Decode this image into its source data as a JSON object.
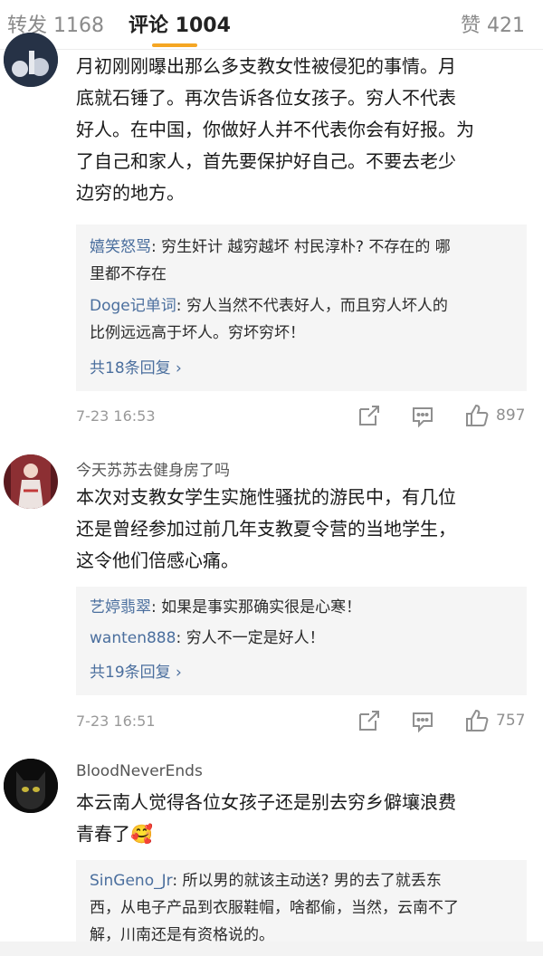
{
  "tabs": {
    "repost": "转发 1168",
    "comment": "评论 1004",
    "like": "赞 421"
  },
  "comments": [
    {
      "text": "月初刚刚曝出那么多支教女性被侵犯的事情。月底就石锤了。再次告诉各位女孩子。穷人不代表好人。在中国，你做好人并不代表你会有好报。为了自己和家人，首先要保护好自己。不要去老少边穷的地方。",
      "lines": [
        "月初刚刚曝出那么多支教女性被侵犯的事情。月",
        "底就石锤了。再次告诉各位女孩子。穷人不代表",
        "好人。在中国，你做好人并不代表你会有好报。为",
        "了自己和家人，首先要保护好自己。不要去老少",
        "边穷的地方。"
      ],
      "replies": [
        {
          "name": "嬉笑怒骂",
          "lines": [
            "穷生奸计 越穷越坏 村民淳朴? 不存在的 哪",
            "里都不存在"
          ]
        },
        {
          "name": "Doge记单词",
          "lines": [
            "穷人当然不代表好人，而且穷人坏人的",
            "比例远远高于坏人。穷坏穷坏！"
          ]
        }
      ],
      "reply_count": "共18条回复 ›",
      "time": "7-23 16:53",
      "likes": "897"
    },
    {
      "username": "今天苏苏去健身房了吗",
      "lines": [
        "本次对支教女学生实施性骚扰的游民中，有几位",
        "还是曾经参加过前几年支教夏令营的当地学生，",
        "这令他们倍感心痛。"
      ],
      "replies": [
        {
          "name": "艺婷翡翠",
          "lines": [
            "如果是事实那确实很是心寒！"
          ]
        },
        {
          "name": "wanten888",
          "lines": [
            "穷人不一定是好人！"
          ]
        }
      ],
      "reply_count": "共19条回复 ›",
      "time": "7-23 16:51",
      "likes": "757"
    },
    {
      "username": "BloodNeverEnds",
      "lines": [
        "本云南人觉得各位女孩子还是别去穷乡僻壤浪费",
        "青春了🥰"
      ],
      "replies": [
        {
          "name": "SinGeno_Jr",
          "lines": [
            "所以男的就该主动送? 男的去了就丢东",
            "西，从电子产品到衣服鞋帽，啥都偷，当然，云南不了",
            "解，川南还是有资格说的。"
          ]
        }
      ]
    }
  ],
  "icons": {
    "share": "share-icon",
    "reply": "comment-icon",
    "like": "thumbs-up-icon"
  },
  "colors": {
    "accent": "#f5a623",
    "link": "#4b6f9e",
    "reply_bg": "#f5f5f5"
  }
}
